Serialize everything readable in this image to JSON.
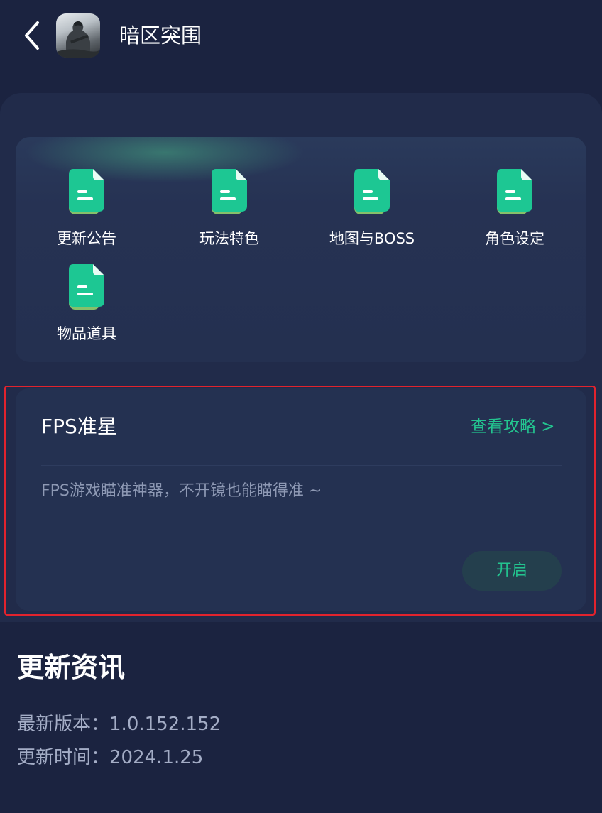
{
  "header": {
    "back_icon": "chevron-left-icon",
    "game_title": "暗区突围"
  },
  "menu": {
    "items": [
      {
        "label": "更新公告",
        "icon": "document-icon"
      },
      {
        "label": "玩法特色",
        "icon": "document-icon"
      },
      {
        "label": "地图与BOSS",
        "icon": "document-icon"
      },
      {
        "label": "角色设定",
        "icon": "document-icon"
      },
      {
        "label": "物品道具",
        "icon": "document-icon"
      }
    ]
  },
  "fps": {
    "title": "FPS准星",
    "guide_link": "查看攻略 >",
    "description": "FPS游戏瞄准神器，不开镜也能瞄得准 ~",
    "enable_button": "开启"
  },
  "news": {
    "heading": "更新资讯",
    "version_label": "最新版本：",
    "version_value": "1.0.152.152",
    "date_label": "更新时间：",
    "date_value": "2024.1.25"
  },
  "colors": {
    "background": "#1b2340",
    "panel": "#212b4a",
    "accent_green": "#23c48f",
    "highlight_red": "#e2232d"
  }
}
